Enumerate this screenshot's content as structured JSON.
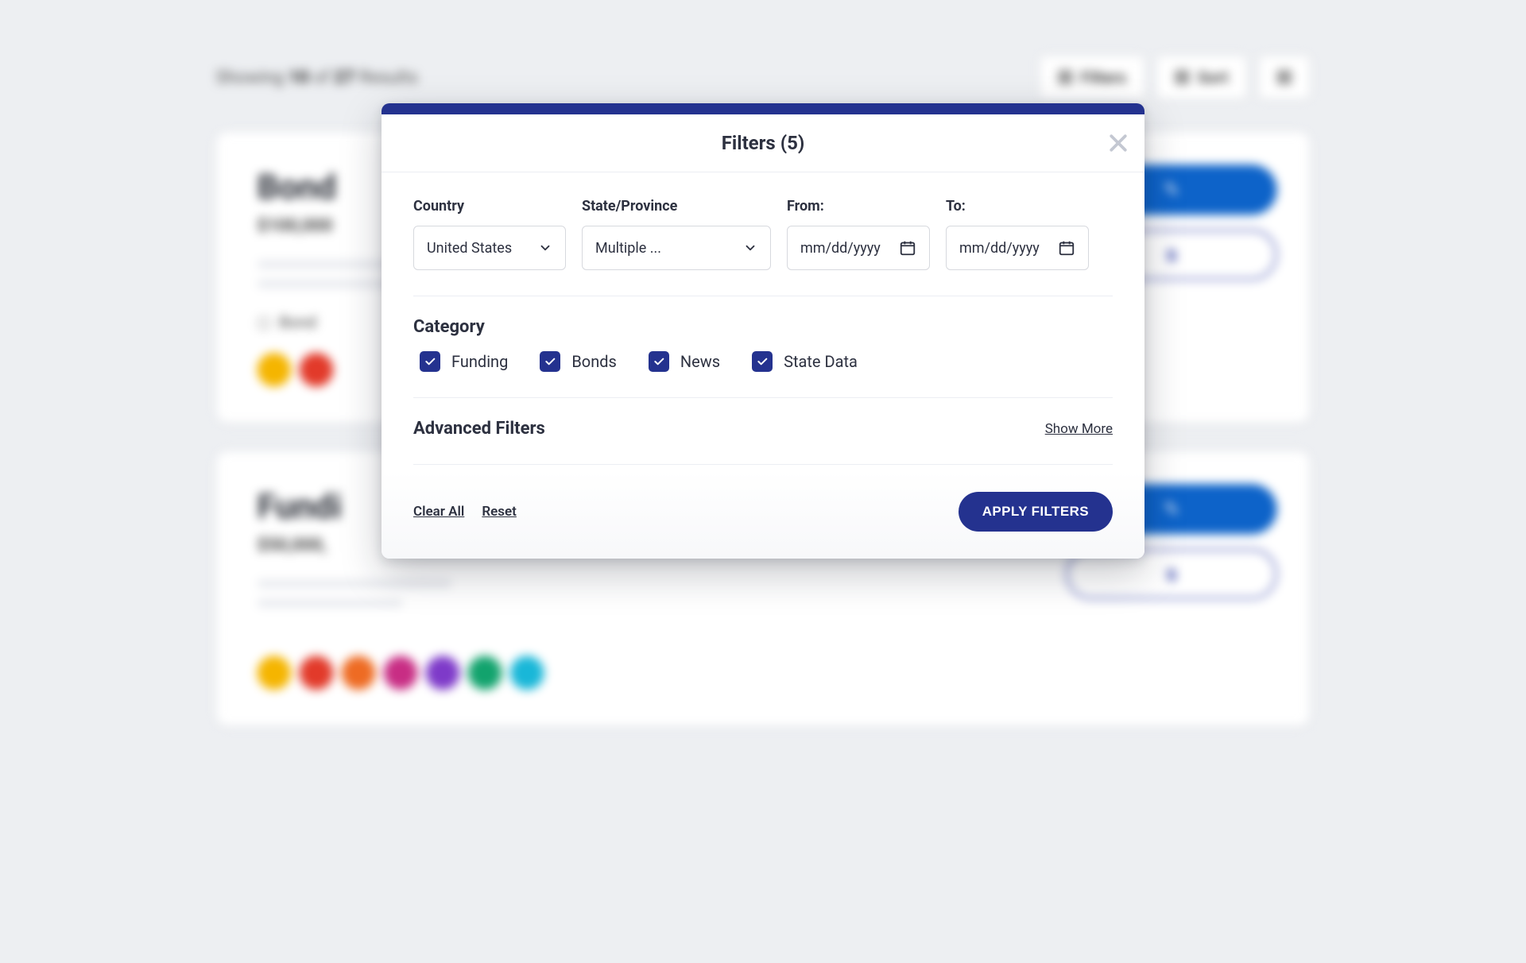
{
  "background": {
    "showing_prefix": "Showing",
    "count_shown": "10",
    "of_word": "of",
    "count_total": "27",
    "results_word": "Results",
    "toolbar": {
      "filters": "Filters",
      "sort": "Sort"
    },
    "cards": [
      {
        "title": "Bond",
        "amount": "$100,000",
        "meta_prefix": "Bond",
        "side_char": "s"
      },
      {
        "title": "Fundi",
        "amount": "$50,000,",
        "meta_prefix": "",
        "side_char": "s"
      }
    ]
  },
  "modal": {
    "title": "Filters (5)",
    "fields": {
      "country": {
        "label": "Country",
        "value": "United States"
      },
      "state": {
        "label": "State/Province",
        "value": "Multiple ..."
      },
      "from": {
        "label": "From:",
        "placeholder": "mm/dd/yyyy"
      },
      "to": {
        "label": "To:",
        "placeholder": "mm/dd/yyyy"
      }
    },
    "category": {
      "heading": "Category",
      "items": [
        {
          "label": "Funding",
          "checked": true
        },
        {
          "label": "Bonds",
          "checked": true
        },
        {
          "label": "News",
          "checked": true
        },
        {
          "label": "State Data",
          "checked": true
        }
      ]
    },
    "advanced": {
      "heading": "Advanced Filters",
      "show_more": "Show More"
    },
    "footer": {
      "clear": "Clear All",
      "reset": "Reset",
      "apply": "APPLY FILTERS"
    }
  }
}
